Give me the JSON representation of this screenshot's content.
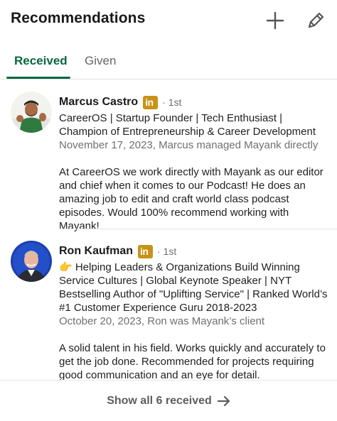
{
  "header": {
    "title": "Recommendations",
    "add_icon": "plus-icon",
    "edit_icon": "pencil-icon"
  },
  "tabs": [
    {
      "label": "Received",
      "active": true
    },
    {
      "label": "Given",
      "active": false
    }
  ],
  "recommendations": [
    {
      "name": "Marcus Castro",
      "badge": "in",
      "degree": "· 1st",
      "headline": "CareerOS | Startup Founder | Tech Enthusiast | Champion of Entrepreneurship & Career Development",
      "meta": "November 17, 2023, Marcus managed Mayank directly",
      "text": "At CareerOS we work directly with Mayank as our editor and chief when it comes to our Podcast! He does an amazing job to edit and craft world class podcast episodes. Would 100% recommend working with Mayank!"
    },
    {
      "name": "Ron Kaufman",
      "badge": "in",
      "degree": "· 1st",
      "headline": "👉 Helping Leaders & Organizations Build Winning Service Cultures | Global Keynote Speaker | NYT Bestselling Author of  \"Uplifting Service\" | Ranked World’s #1 Customer Experience Guru 2018-2023",
      "meta": "October 20, 2023, Ron was Mayank’s client",
      "text": "A solid talent in his field. Works quickly and accurately to get the job done. Recommended for projects requiring good communication and an eye for detail."
    }
  ],
  "footer": {
    "show_all_label": "Show all 6 received",
    "arrow_icon": "arrow-right-icon"
  },
  "colors": {
    "accent": "#0a6640",
    "badge": "#c79216",
    "muted": "#707070"
  }
}
